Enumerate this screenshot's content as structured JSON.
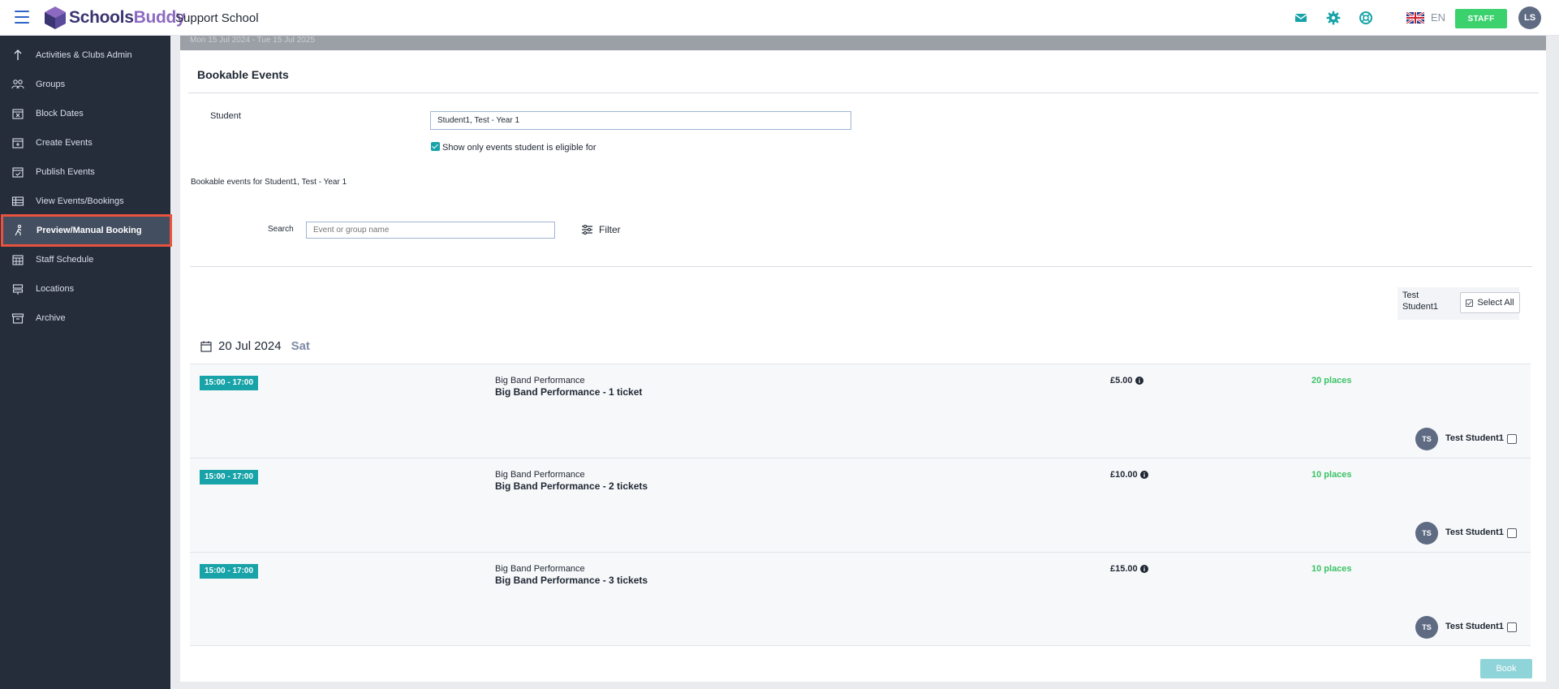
{
  "app": {
    "brand_part1": "Schools",
    "brand_part2": "Buddy",
    "school_name": "Support School"
  },
  "header": {
    "lang": "EN",
    "role_label": "STAFF",
    "user_initials": "LS",
    "icons": [
      "mail-icon",
      "gear-icon",
      "lifebuoy-icon",
      "uk-flag-icon"
    ]
  },
  "sidebar": {
    "items": [
      {
        "label": "Activities & Clubs Admin",
        "icon": "arrow-up-icon"
      },
      {
        "label": "Groups",
        "icon": "groups-icon"
      },
      {
        "label": "Block Dates",
        "icon": "calendar-x-icon"
      },
      {
        "label": "Create Events",
        "icon": "calendar-plus-icon"
      },
      {
        "label": "Publish Events",
        "icon": "calendar-check-icon"
      },
      {
        "label": "View Events/Bookings",
        "icon": "table-icon"
      },
      {
        "label": "Preview/Manual Booking",
        "icon": "person-walk-icon",
        "active": true
      },
      {
        "label": "Staff Schedule",
        "icon": "calendar-grid-icon"
      },
      {
        "label": "Locations",
        "icon": "signpost-icon"
      },
      {
        "label": "Archive",
        "icon": "archive-icon"
      }
    ]
  },
  "banner": {
    "text": "Mon 15 Jul 2024 - Tue 15 Jul 2025"
  },
  "main": {
    "title": "Bookable Events",
    "student_label": "Student",
    "student_value": "Student1, Test - Year 1",
    "eligible_label": "Show only events student is eligible for",
    "eligible_checked": true,
    "bookable_for": "Bookable events for Student1, Test - Year 1",
    "search_label": "Search",
    "search_placeholder": "Event or group name",
    "filter_label": "Filter",
    "select_student_name": "Test Student1",
    "select_all_label": "Select All",
    "date": "20 Jul 2024",
    "day": "Sat",
    "book_label": "Book"
  },
  "events": [
    {
      "time": "15:00  - 17:00",
      "group": "Big Band Performance",
      "name": "Big Band Performance - 1 ticket",
      "price": "£5.00",
      "places": "20 places",
      "student_initials": "TS",
      "student": "Test Student1"
    },
    {
      "time": "15:00  - 17:00",
      "group": "Big Band Performance",
      "name": "Big Band Performance - 2 tickets",
      "price": "£10.00",
      "places": "10 places",
      "student_initials": "TS",
      "student": "Test Student1"
    },
    {
      "time": "15:00  - 17:00",
      "group": "Big Band Performance",
      "name": "Big Band Performance - 3 tickets",
      "price": "£15.00",
      "places": "10 places",
      "student_initials": "TS",
      "student": "Test Student1"
    }
  ],
  "colors": {
    "sidebar_bg": "#252d3a",
    "accent_teal": "#17a3a8",
    "places_green": "#3bc365",
    "staff_green": "#3bd26e",
    "active_outline": "#e9523f",
    "brand_dark": "#3a3470",
    "brand_purple": "#8d6ac2"
  }
}
